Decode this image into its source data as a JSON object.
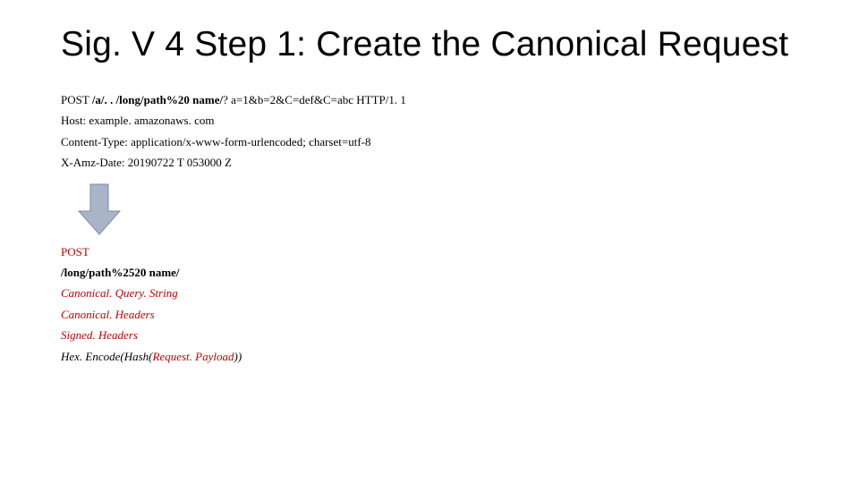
{
  "title": "Sig. V 4 Step 1: Create the Canonical Request",
  "request": {
    "line1_pre": "POST ",
    "line1_bold": "/a/. . /long/path%20 name/",
    "line1_post": "? a=1&b=2&C=def&C=abc HTTP/1. 1",
    "line2": "Host: example. amazonaws. com",
    "line3": "Content-Type: application/x-www-form-urlencoded; charset=utf-8",
    "line4": "X-Amz-Date: 20190722 T 053000 Z"
  },
  "canonical": {
    "line1": "POST",
    "line2": "/long/path%2520 name/",
    "line3": "Canonical. Query. String",
    "line4": "Canonical. Headers",
    "line5": "Signed. Headers",
    "line6_pre": "Hex. Encode(Hash(",
    "line6_mid": "Request. Payload",
    "line6_post": "))"
  },
  "colors": {
    "accent_red": "#c00000",
    "arrow_fill": "#a9b5c7",
    "arrow_stroke": "#7d8aa0"
  }
}
